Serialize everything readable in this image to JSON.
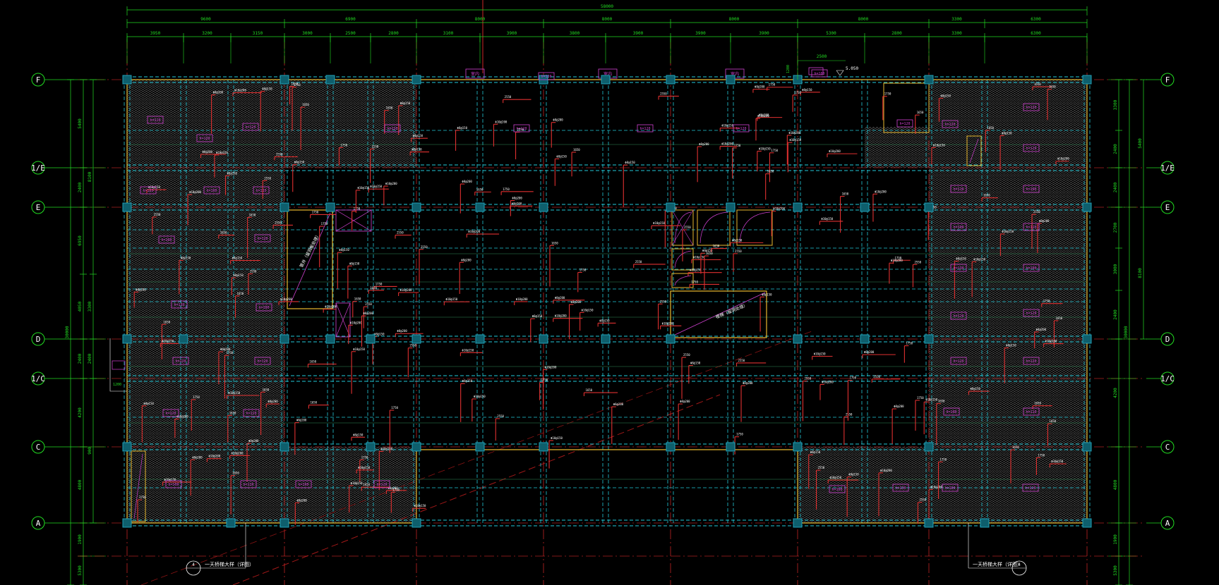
{
  "colors": {
    "background": "#000000",
    "grid_axis": "#ff3030",
    "dimension": "#22dd22",
    "beam_dashed": "#22c8d8",
    "wall_outline": "#e8b830",
    "rebar": "#e03030",
    "rebar_label": "#ffffff",
    "room_tag": "#d040d0",
    "column": "#20a0b8",
    "hatch": "#555555",
    "opening_mark": "#d040d0",
    "diagonal_guide": "#c02020"
  },
  "drawing": {
    "overall_dim": "58000",
    "top_dims_row1": [
      "9600",
      "6900",
      "8000",
      "8000",
      "8000",
      "8000",
      "3300",
      "6300"
    ],
    "top_dims_row2": [
      "3950",
      "3200",
      "3150",
      "3000",
      "2500",
      "2800",
      "3100",
      "3900",
      "3800",
      "3900",
      "3900",
      "3900",
      "5300",
      "2800",
      "3300",
      "6300"
    ],
    "top_note_dim": "2500",
    "top_elevation": "5.050",
    "top_height_dim": "1200",
    "axis_labels_left": [
      "F",
      "1/E",
      "E",
      "D",
      "1/C",
      "C",
      "A"
    ],
    "axis_labels_right": [
      "F",
      "1/E",
      "E",
      "D",
      "1/C",
      "C",
      "A"
    ],
    "left_dims_row1": [
      "5400",
      "2400",
      "6950",
      "4050",
      "2400",
      "4200",
      "4800",
      "1900",
      "5300"
    ],
    "left_dims_row2": [
      "8100",
      "3300",
      "2400",
      "900"
    ],
    "left_total_dim": "30000",
    "right_dims_row1": [
      "3300",
      "2400",
      "2400",
      "2700",
      "3000",
      "2400",
      "4200",
      "4800",
      "1900",
      "5300"
    ],
    "right_dims_row2": [
      "5400",
      "8100"
    ],
    "right_total_dim": "30000",
    "opening_tags": [
      "室内",
      "室内",
      "室内"
    ],
    "slab_thickness_tags": [
      "h=120",
      "h=120",
      "h=120",
      "h=120",
      "h=100",
      "h=110",
      "h=100",
      "h=120",
      "h=130",
      "h=100"
    ],
    "shaft_note": "管井（留洞板处理）",
    "shaft_note_2": "楼梯（留洞处理）",
    "rebar_sample_labels": [
      "Φ8@150",
      "Φ8@200",
      "Φ10@150",
      "Φ10@200",
      "1750",
      "1650",
      "2550"
    ],
    "stair_callout_left": "一天桥梯大样（详图）",
    "stair_callout_right": "一天桥梯大样（详图）",
    "stair_callout_left_num": "4",
    "stair_callout_right_num": "4",
    "left_step_dim": "1200"
  }
}
